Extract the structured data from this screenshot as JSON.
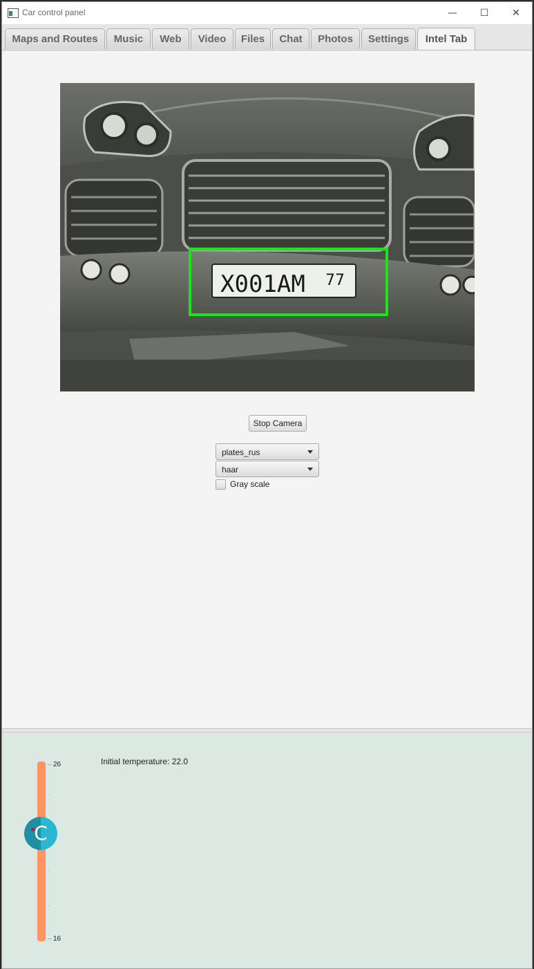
{
  "window": {
    "title": "Car control panel",
    "controls": {
      "minimize": "—",
      "maximize": "☐",
      "close": "✕"
    }
  },
  "tabs": [
    {
      "label": "Maps and Routes"
    },
    {
      "label": "Music"
    },
    {
      "label": "Web"
    },
    {
      "label": "Video"
    },
    {
      "label": "Files"
    },
    {
      "label": "Chat"
    },
    {
      "label": "Photos"
    },
    {
      "label": "Settings"
    },
    {
      "label": "Intel Tab",
      "active": true
    }
  ],
  "camera": {
    "plate_text": "X001AM",
    "plate_region": "77",
    "detection_color": "#19e619"
  },
  "controls": {
    "stop_camera_label": "Stop Camera",
    "model_select": "plates_rus",
    "method_select": "haar",
    "grayscale_label": "Gray scale",
    "grayscale_checked": false
  },
  "climate": {
    "temperature_label": "Initial temperature: 22.0",
    "slider_max": "26",
    "slider_min": "16",
    "slider_value": 22,
    "knob_letter": "C",
    "track_color": "#ff9462",
    "knob_color": "#2bb7d2"
  }
}
